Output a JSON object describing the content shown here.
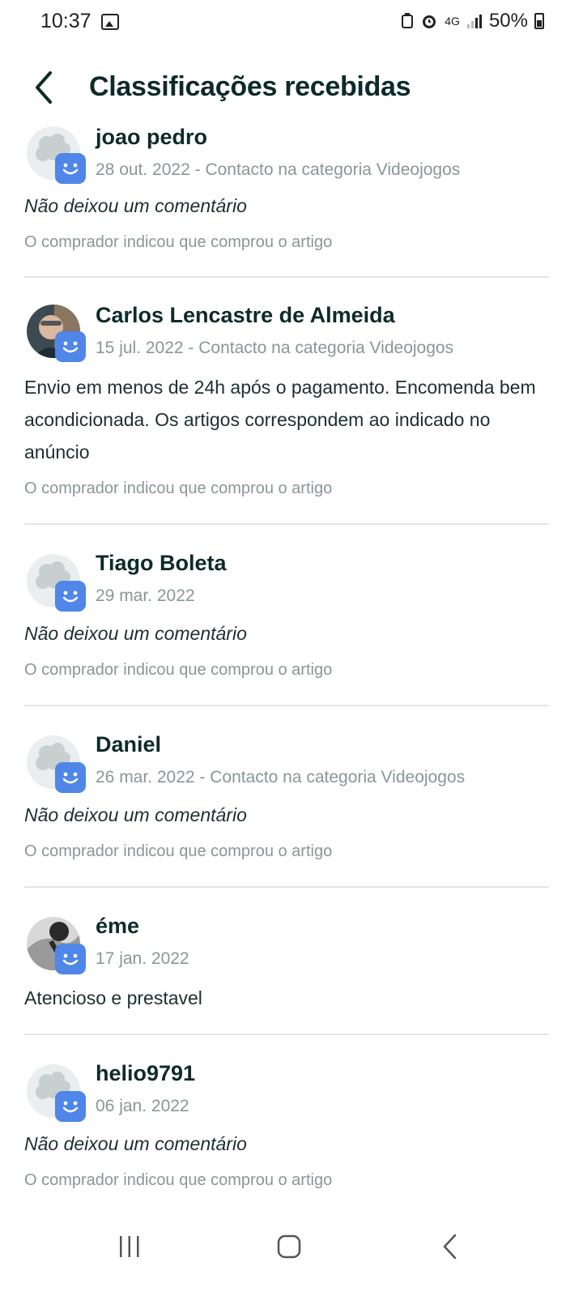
{
  "status": {
    "time": "10:37",
    "battery": "50%",
    "network": "4G"
  },
  "header": {
    "title": "Classificações recebidas"
  },
  "reviews": [
    {
      "name": "joao pedro",
      "date": "28 out. 2022",
      "context": " - Contacto na categoria Videojogos",
      "comment": "Não deixou um comentário",
      "note": "O comprador indicou que comprou o artigo",
      "avatar": "default"
    },
    {
      "name": "Carlos Lencastre de Almeida",
      "date": "15 jul. 2022",
      "context": " - Contacto na categoria Videojogos",
      "comment": "Envio em menos de 24h após o pagamento. Encomenda bem acondicionada. Os artigos correspondem ao indicado no anúncio",
      "note": "O comprador indicou que comprou o artigo",
      "avatar": "photo"
    },
    {
      "name": "Tiago Boleta",
      "date": "29 mar. 2022",
      "context": "",
      "comment": "Não deixou um comentário",
      "note": "O comprador indicou que comprou o artigo",
      "avatar": "default"
    },
    {
      "name": "Daniel",
      "date": "26 mar. 2022",
      "context": " - Contacto na categoria Videojogos",
      "comment": "Não deixou um comentário",
      "note": "O comprador indicou que comprou o artigo",
      "avatar": "default"
    },
    {
      "name": "éme",
      "date": "17 jan. 2022",
      "context": "",
      "comment": "Atencioso e prestavel",
      "note": "",
      "avatar": "photo-bw"
    },
    {
      "name": "helio9791",
      "date": "06 jan. 2022",
      "context": "",
      "comment": "Não deixou um comentário",
      "note": "O comprador indicou que comprou o artigo",
      "avatar": "default"
    }
  ],
  "colors": {
    "badge": "#4f86e8",
    "title": "#0e2a2a",
    "muted": "#8a9697",
    "divider": "#e2e6e6"
  }
}
